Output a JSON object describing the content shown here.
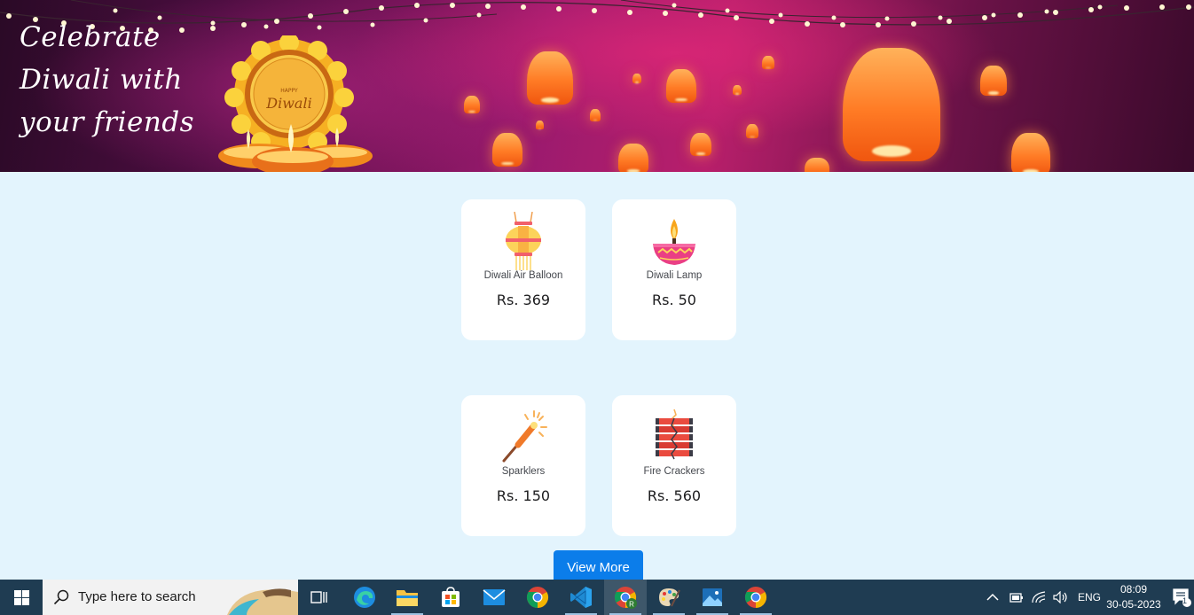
{
  "banner": {
    "headline_line1": "Celebrate",
    "headline_line2": "Diwali with",
    "headline_line3": "your friends",
    "emblem_small": "HAPPY",
    "emblem_text": "Diwali"
  },
  "products": [
    {
      "name": "Diwali Air Balloon",
      "price": "Rs. 369",
      "icon": "lantern-icon"
    },
    {
      "name": "Diwali Lamp",
      "price": "Rs. 50",
      "icon": "diya-icon"
    },
    {
      "name": "Sparklers",
      "price": "Rs. 150",
      "icon": "sparkler-icon"
    },
    {
      "name": "Fire Crackers",
      "price": "Rs. 560",
      "icon": "firecracker-icon"
    }
  ],
  "view_more_label": "View More",
  "taskbar": {
    "search_placeholder": "Type here to search",
    "apps": [
      "task-view",
      "edge",
      "file-explorer",
      "microsoft-store",
      "mail",
      "chrome",
      "vscode",
      "chrome-profile",
      "paint",
      "photos",
      "chrome"
    ],
    "language": "ENG",
    "time": "08:09",
    "date": "30-05-2023",
    "notification_count": "1"
  },
  "colors": {
    "page_bg": "#e3f4fd",
    "button_blue": "#0b7dea",
    "taskbar": "#1f3c52"
  }
}
